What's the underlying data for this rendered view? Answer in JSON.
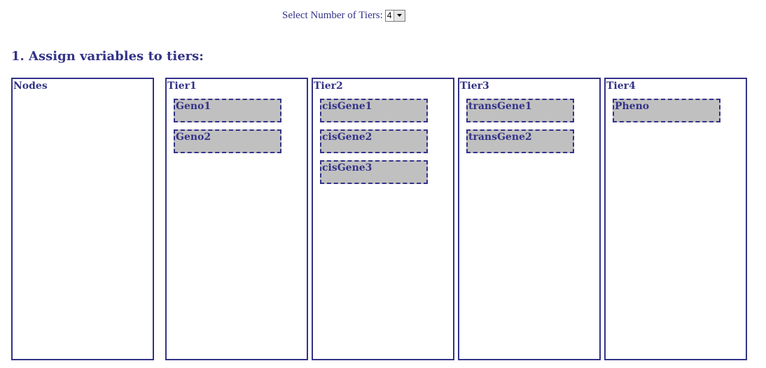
{
  "tier_selector": {
    "label": "Select Number of Tiers:",
    "selected_value": "4",
    "dropdown_icon": "chevron-down-icon"
  },
  "section": {
    "title": "1. Assign variables to tiers:"
  },
  "colors": {
    "accent": "#333388",
    "item_background": "#c0c0c0"
  },
  "columns": [
    {
      "title": "Nodes",
      "items": []
    },
    {
      "title": "Tier1",
      "items": [
        "Geno1",
        "Geno2"
      ]
    },
    {
      "title": "Tier2",
      "items": [
        "cisGene1",
        "cisGene2",
        "cisGene3"
      ]
    },
    {
      "title": "Tier3",
      "items": [
        "transGene1",
        "transGene2"
      ]
    },
    {
      "title": "Tier4",
      "items": [
        "Pheno"
      ]
    }
  ]
}
